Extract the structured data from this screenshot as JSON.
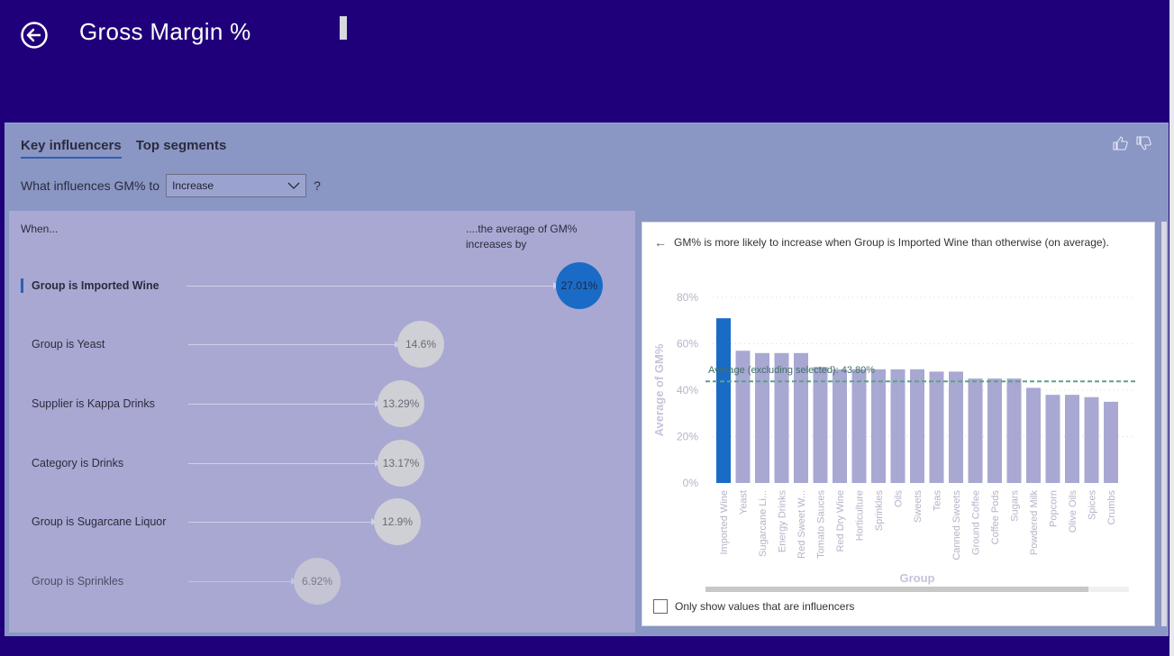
{
  "header": {
    "title": "Gross Margin %",
    "back_icon": "back-arrow-circle-icon"
  },
  "tabs": [
    {
      "label": "Key influencers",
      "active": true
    },
    {
      "label": "Top segments",
      "active": false
    }
  ],
  "feedback": {
    "thumbs_up_icon": "thumbs-up-icon",
    "thumbs_down_icon": "thumbs-down-icon"
  },
  "question": {
    "prefix": "What influences GM% to",
    "selected": "Increase",
    "suffix": "?"
  },
  "columns": {
    "when": "When...",
    "average_line1": "....the average of GM%",
    "average_line2": "increases by"
  },
  "influencers": [
    {
      "label": "Group is Imported Wine",
      "value": "27.01%",
      "selected": true
    },
    {
      "label": "Group is Yeast",
      "value": "14.6%",
      "selected": false
    },
    {
      "label": "Supplier is Kappa Drinks",
      "value": "13.29%",
      "selected": false
    },
    {
      "label": "Category is Drinks",
      "value": "13.17%",
      "selected": false
    },
    {
      "label": "Group is Sugarcane Liquor",
      "value": "12.9%",
      "selected": false
    },
    {
      "label": "Group is Sprinkles",
      "value": "6.92%",
      "selected": false
    }
  ],
  "detail": {
    "heading": "GM% is more likely to increase when Group is Imported Wine than otherwise (on average).",
    "only_show_label": "Only show values that are influencers",
    "only_show_checked": false
  },
  "chart_data": {
    "type": "bar",
    "ylabel": "Average of GM%",
    "xlabel": "Group",
    "ylim": [
      0,
      80
    ],
    "yticks": [
      "0%",
      "20%",
      "40%",
      "60%",
      "80%"
    ],
    "categories": [
      "Imported Wine",
      "Yeast",
      "Sugarcane Li...",
      "Energy Drinks",
      "Red Sweet W...",
      "Tomato Sauces",
      "Red Dry Wine",
      "Horticulture",
      "Sprinkles",
      "Oils",
      "Sweets",
      "Teas",
      "Canned Sweets",
      "Ground Coffee",
      "Coffee Pods",
      "Sugars",
      "Powdered Milk",
      "Popcorn",
      "Olive Oils",
      "Spices",
      "Crumbs"
    ],
    "values": [
      71,
      57,
      56,
      56,
      56,
      50,
      49,
      49,
      49,
      49,
      49,
      48,
      48,
      45,
      45,
      45,
      41,
      38,
      38,
      37,
      35
    ],
    "highlighted_index": 0,
    "average_line": {
      "value": 43.8,
      "label": "Average (excluding selected): 43.80%"
    },
    "colors": {
      "highlight": "#1a6bc6",
      "bar": "#a8a8d2",
      "average": "#5fa08a",
      "grid": "#d8d8d8",
      "tick": "#b4b4c8"
    }
  }
}
